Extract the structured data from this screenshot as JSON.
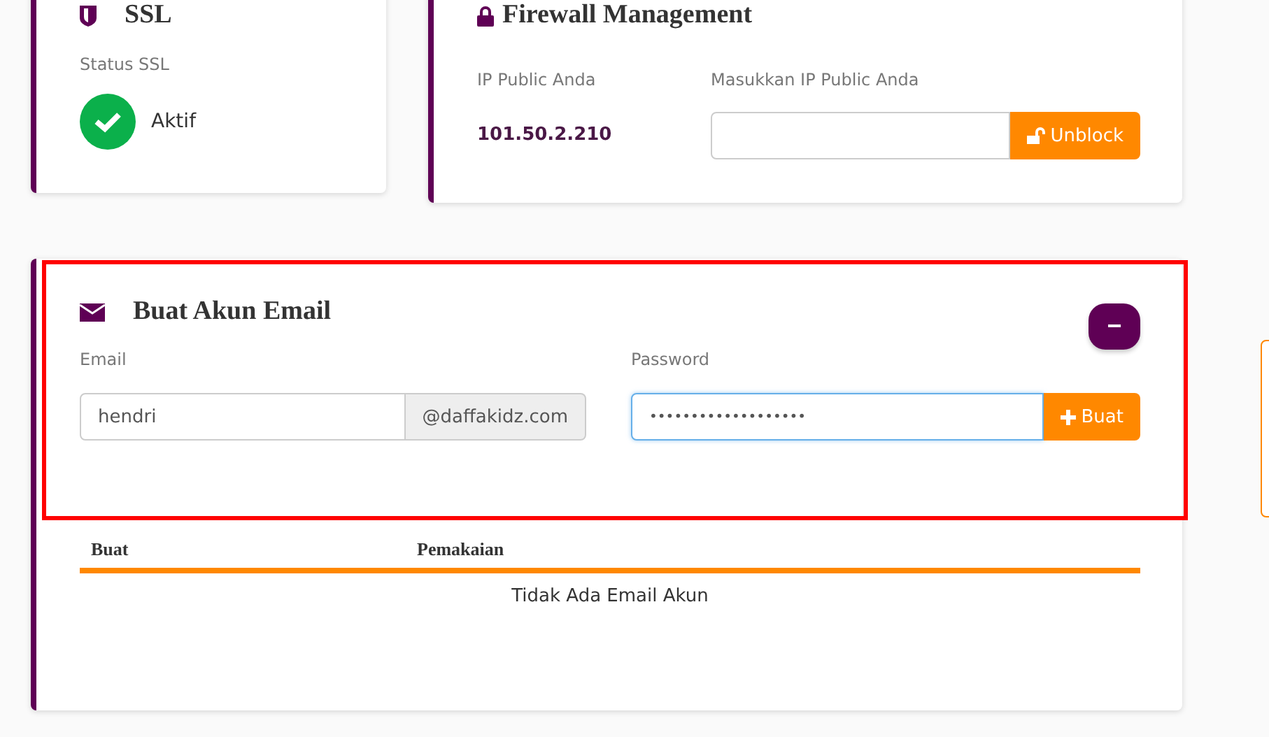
{
  "ssl_card": {
    "title": "SSL",
    "status_label": "Status SSL",
    "status": {
      "active": true,
      "text": "Aktif"
    }
  },
  "firewall_card": {
    "title": "Firewall Management",
    "ip_label": "IP Public Anda",
    "ip_value": "101.50.2.210",
    "input_label": "Masukkan IP Public Anda",
    "unblock_button": "Unblock"
  },
  "email_card": {
    "title": "Buat Akun Email",
    "collapse_button": "−",
    "email_label": "Email",
    "email_value": "hendri",
    "domain": "@daffakidz.com",
    "password_label": "Password",
    "password_value": "•••••••••••••••••••",
    "create_button": "Buat",
    "highlighted": true,
    "table": {
      "columns": [
        "Buat",
        "Pemakaian"
      ],
      "empty_text": "Tidak Ada Email Akun"
    }
  }
}
